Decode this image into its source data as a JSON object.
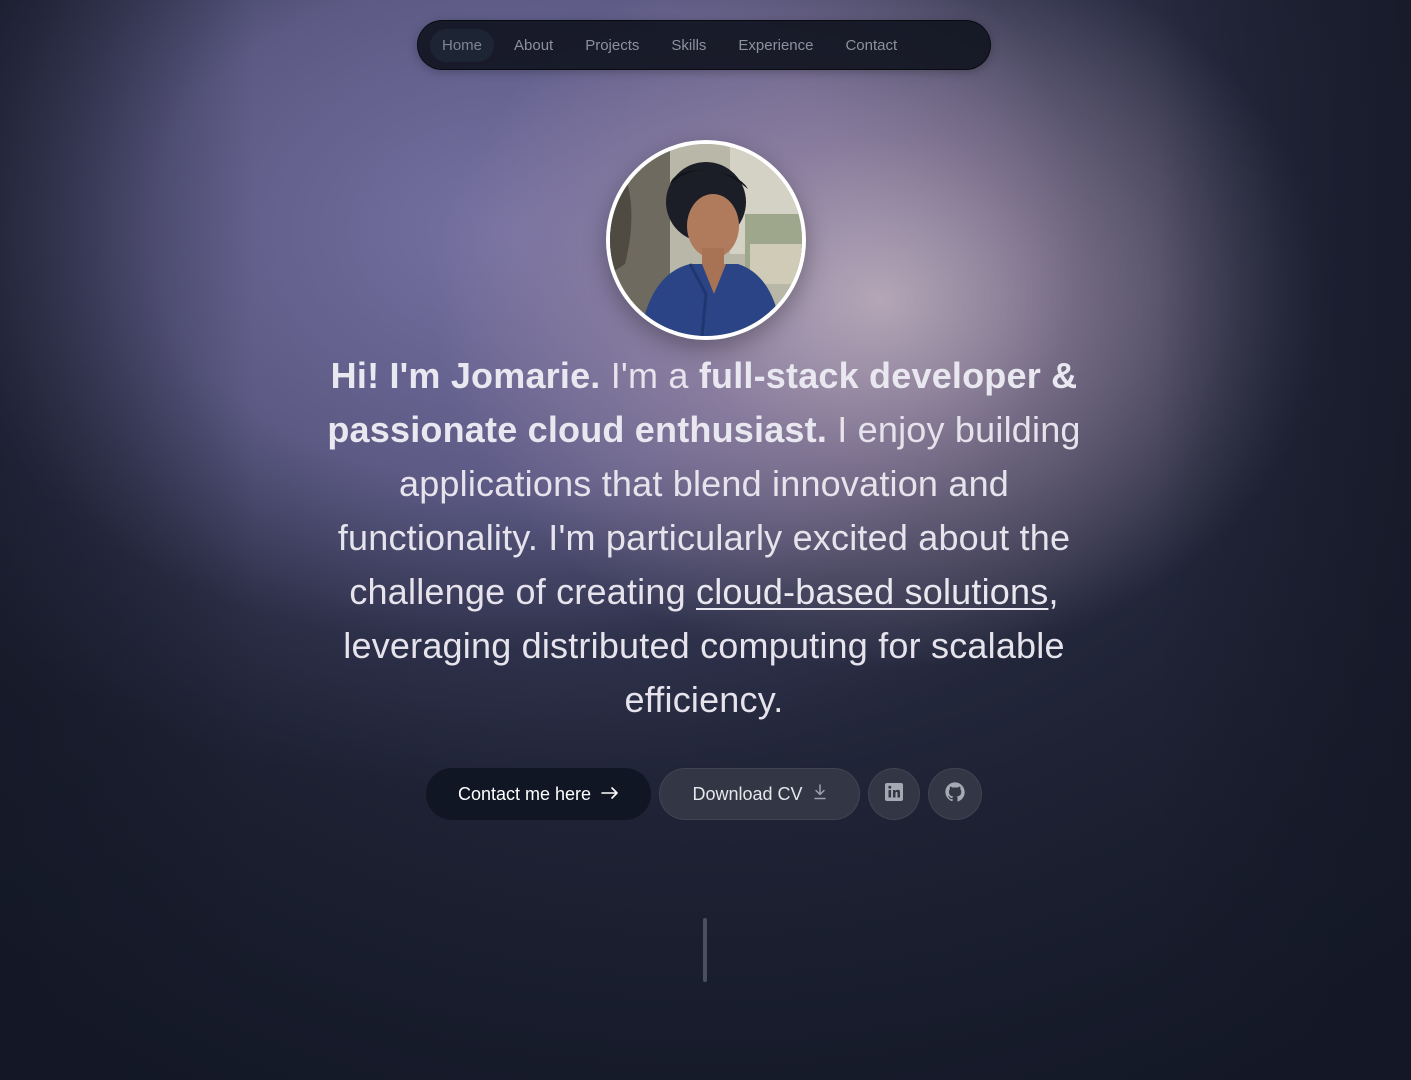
{
  "nav": {
    "items": [
      {
        "label": "Home",
        "active": true
      },
      {
        "label": "About"
      },
      {
        "label": "Projects"
      },
      {
        "label": "Skills"
      },
      {
        "label": "Experience"
      },
      {
        "label": "Contact"
      }
    ]
  },
  "hero": {
    "greeting": "Hi! I'm Jomarie.",
    "intro_1": " I'm a ",
    "role": "full-stack developer & passionate cloud enthusiast.",
    "intro_2": " I enjoy building applications that blend innovation and functionality. I'm particularly excited about the challenge of creating ",
    "link_text": "cloud-based solutions",
    "intro_3": ", leveraging distributed computing for scalable efficiency."
  },
  "actions": {
    "contact_label": "Contact me here",
    "contact_icon": "arrow-right-icon",
    "download_label": "Download CV",
    "download_icon": "download-icon",
    "linkedin_icon": "linkedin-icon",
    "github_icon": "github-icon"
  },
  "colors": {
    "primary_button": "#111624",
    "secondary_button": "#323645",
    "background": "#131826"
  }
}
